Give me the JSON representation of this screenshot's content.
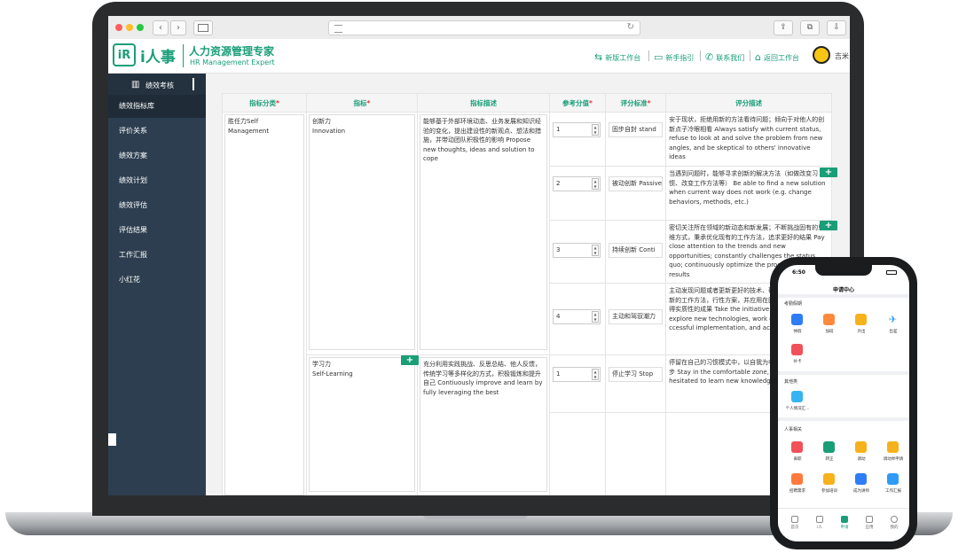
{
  "browser": {
    "nav": {
      "back": "‹",
      "forward": "›"
    },
    "reload_glyph": "↻",
    "actions": {
      "share": "⇪",
      "tabs": "⧉",
      "download": "⇩"
    },
    "dot_colors": [
      "#ff5f57",
      "#febc2e",
      "#28c840"
    ]
  },
  "header": {
    "logo_mark": "iR",
    "logo_text": "i人事",
    "brand_cn": "人力资源管理专家",
    "brand_en": "HR Management Expert",
    "links": [
      {
        "icon": "swap-arrows-icon",
        "label": "新版工作台"
      },
      {
        "icon": "book-icon",
        "label": "新手指引"
      },
      {
        "icon": "phone-icon",
        "label": "联系我们"
      },
      {
        "icon": "home-icon",
        "label": "返回工作台"
      }
    ],
    "user_name": "吉米"
  },
  "sidebar": {
    "title": "绩效考核",
    "items": [
      {
        "label": "绩效指标库",
        "active": true
      },
      {
        "label": "评价关系",
        "active": false
      },
      {
        "label": "绩效方案",
        "active": false
      },
      {
        "label": "绩效计划",
        "active": false
      },
      {
        "label": "绩效评估",
        "active": false
      },
      {
        "label": "评估结果",
        "active": false
      },
      {
        "label": "工作汇报",
        "active": false
      },
      {
        "label": "小红花",
        "active": false
      }
    ]
  },
  "table": {
    "headers": [
      "指标分类",
      "指标",
      "指标描述",
      "参考分值",
      "评分标准",
      "评分描述"
    ],
    "required_mark": "*",
    "category": "胜任力Self Management",
    "indicators": [
      {
        "name_cn": "创新力",
        "name_en": "Innovation",
        "description": "能够基于外部环境动态、业务发展和知识经验的变化，提出建设性的新观点、想法和措施，并带动团队积极性的影响 Propose new thoughts, ideas and solution to cope",
        "levels": [
          {
            "score": "1",
            "standard": "固步自封  stand",
            "desc": "安于现状，拒绝用新的方法看待问题；倾向于对他人的创新点子冷眼相看 Always satisfy with current status, refuse to look at and solve the problem from new angles, and be skeptical to others' innovative ideas"
          },
          {
            "score": "2",
            "standard": "被动创新 Passive",
            "desc": "当遇到问题时，能够寻求创新的解决方法（如做改变习惯、改变工作方法等） Be able to find a new solution when current way does not work (e.g. change behaviors, methods, etc.)"
          },
          {
            "score": "3",
            "standard": "持续创新 Conti",
            "desc": "密切关注所在领域的新动态和新发展；不断挑战固有的思维方式，秉承优化现有的工作方法，追求更好的结果 Pay close attention to the trends and new opportunities; constantly challenges the status quo; continuously optimize the process and etter results"
          },
          {
            "score": "4",
            "standard": "主动和驾驭潮力",
            "desc": "主动发现问题或者更新更好的技术、研究开发新的流程和新的工作方法，行性方案，并应用在团队乃至跨部门，取得实质性的成果 Take the initiative to identify and explore new technologies, work out effective ccessful implementation, and achieve results"
          }
        ]
      },
      {
        "name_cn": "学习力",
        "name_en": "Self-Learning",
        "description": "充分利用实践挑战、反思总结、他人反馈，传统学习等多样化的方式，积极锻炼和提升自己 Contiuously improve and learn by fully leveraging the best",
        "levels": [
          {
            "score": "1",
            "standard": "停止学习 Stop",
            "desc": "停留在自己的习惯模式中，以自我为中心，不努力求得进步 Stay in the comfortable zone, being back, hesitated to learn new knowledge and methods"
          }
        ]
      }
    ],
    "add_glyph": "+"
  },
  "phone": {
    "time": "6:50",
    "title": "申请中心",
    "sections": [
      {
        "title": "考勤假期",
        "items": [
          {
            "label": "休假",
            "color": "#2f7df6"
          },
          {
            "label": "加班",
            "color": "#ff8a3d"
          },
          {
            "label": "外出",
            "color": "#f5b21c"
          },
          {
            "label": "出差",
            "color": "#2f9bf6"
          },
          {
            "label": "补卡",
            "color": "#f0515b"
          }
        ]
      },
      {
        "title": "其他类",
        "items": [
          {
            "label": "个人情况汇...",
            "color": "#36b3f2"
          }
        ]
      },
      {
        "title": "人事相关",
        "items": [
          {
            "label": "离职",
            "color": "#f0515b"
          },
          {
            "label": "转正",
            "color": "#1a9e78"
          },
          {
            "label": "调动",
            "color": "#f5b21c"
          },
          {
            "label": "调动举申请",
            "color": "#f5b21c"
          },
          {
            "label": "招聘需求",
            "color": "#ff7a3d"
          },
          {
            "label": "参加培训",
            "color": "#f5b21c"
          },
          {
            "label": "成为讲师",
            "color": "#2f7df6"
          },
          {
            "label": "工作汇报",
            "color": "#2f9bf6"
          }
        ]
      }
    ],
    "tabs": [
      {
        "label": "首页",
        "active": false
      },
      {
        "label": "i人",
        "active": false
      },
      {
        "label": "申请",
        "active": true
      },
      {
        "label": "应用",
        "active": false
      },
      {
        "label": "我的",
        "active": false
      }
    ]
  }
}
